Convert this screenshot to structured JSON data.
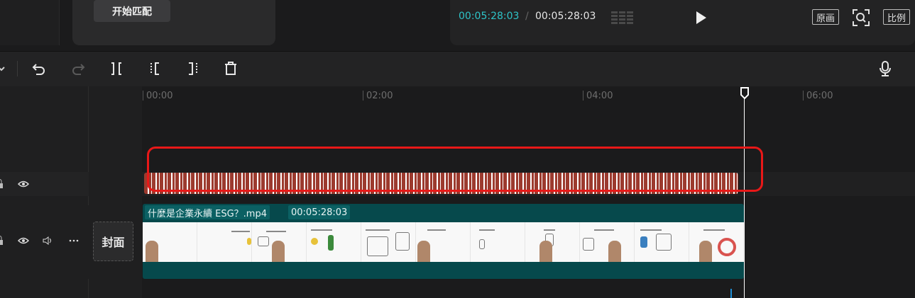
{
  "match": {
    "button_label": "开始匹配"
  },
  "player": {
    "current_time": "00:05:28:03",
    "separator": "/",
    "total_time": "00:05:28:03",
    "original_label": "原画",
    "ratio_label": "比例"
  },
  "toolbar": {
    "icons": [
      "dropdown-icon",
      "undo-icon",
      "redo-icon",
      "split-icon",
      "trim-left-icon",
      "trim-right-icon",
      "delete-icon",
      "microphone-icon"
    ]
  },
  "ruler": {
    "ticks": [
      "00:00",
      "02:00",
      "04:00",
      "06:00"
    ]
  },
  "tracks": {
    "video_clip": {
      "name": "什麼是企業永續 ESG？.mp4",
      "duration": "00:05:28:03"
    },
    "cover_label": "封面"
  },
  "colors": {
    "accent_timecode": "#2ec4c8",
    "video_clip": "#06494c",
    "subtitle_clip": "#9c3a2e",
    "highlight": "#e81818",
    "playhead": "#ffffff"
  }
}
